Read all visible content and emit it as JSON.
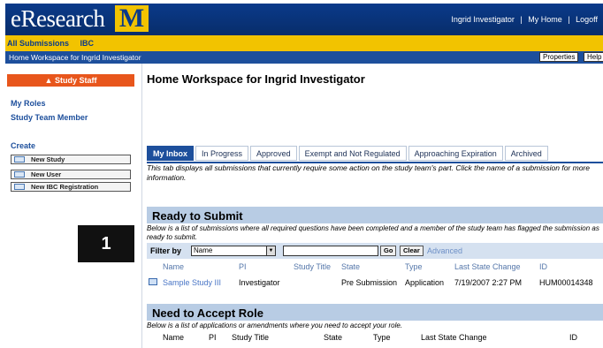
{
  "header": {
    "logo_text": "eResearch",
    "logo_mark": "M",
    "user_links": [
      "Ingrid Investigator",
      "|",
      "My Home",
      "|",
      "Logoff"
    ]
  },
  "nav": {
    "tabs": [
      "All Submissions",
      "IBC"
    ]
  },
  "breadcrumb": {
    "text": "Home Workspace for Ingrid Investigator",
    "properties_label": "Properties",
    "help_label": "Help"
  },
  "left": {
    "study_staff_label": "Study Staff",
    "my_roles_heading": "My Roles",
    "role_link": "Study Team Member",
    "create_heading": "Create",
    "create_buttons": [
      "New Study",
      "New User",
      "New IBC Registration"
    ],
    "callout_number": "1"
  },
  "main": {
    "title": "Home Workspace for Ingrid Investigator",
    "tabs": [
      "My Inbox",
      "In Progress",
      "Approved",
      "Exempt and Not Regulated",
      "Approaching Expiration",
      "Archived"
    ],
    "tab_description": "This tab displays all submissions that currently require some action on the study team's part. Click the name of a submission for more information.",
    "ready": {
      "heading": "Ready to Submit",
      "description": "Below is a list of submissions where all required questions have been completed and a member of the study team has flagged the submission as ready to submit.",
      "filter_label": "Filter by",
      "filter_value": "Name",
      "filter_text_value": "",
      "go_label": "Go",
      "clear_label": "Clear",
      "advanced_label": "Advanced",
      "columns": [
        "Name",
        "PI",
        "Study Title",
        "State",
        "Type",
        "Last State Change",
        "ID"
      ],
      "rows": [
        {
          "name": "Sample Study III",
          "pi": "Investigator",
          "state": "Pre Submission",
          "type": "Application",
          "change": "7/19/2007 2:27 PM",
          "id": "HUM00014348"
        }
      ]
    },
    "accept": {
      "heading": "Need to Accept Role",
      "description": "Below is a list of applications or amendments where you need to accept your role.",
      "columns": [
        "Name",
        "PI",
        "Study Title",
        "State",
        "Type",
        "Last State Change",
        "ID"
      ]
    }
  },
  "colors": {
    "header_blue": "#0a3a8a",
    "nav_yellow": "#f2c300",
    "accent_orange": "#e8561c",
    "section_blue": "#b8cce4"
  }
}
